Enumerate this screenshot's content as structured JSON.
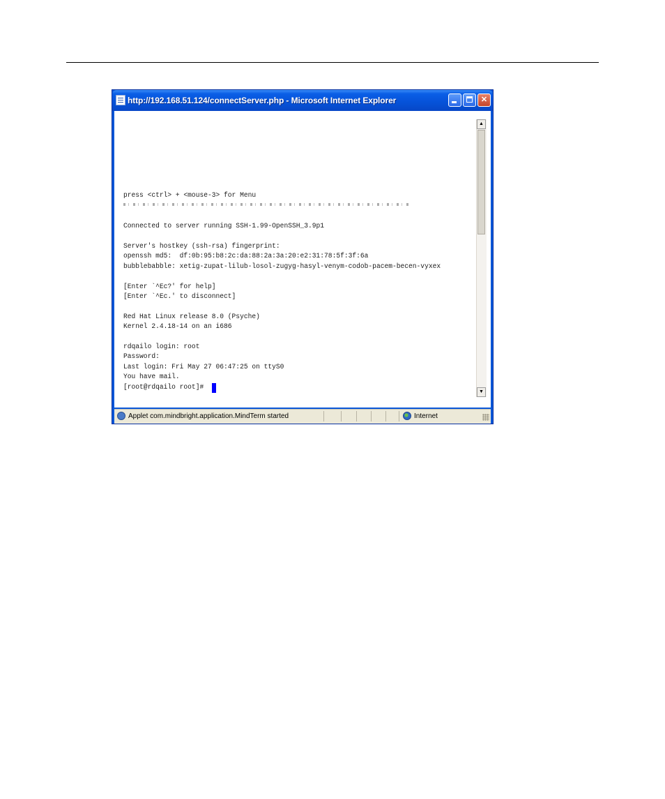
{
  "window": {
    "title": "http://192.168.51.124/connectServer.php - Microsoft Internet Explorer"
  },
  "terminal": {
    "lines": [
      "press <ctrl> + <mouse-3> for Menu",
      "Connected to server running SSH-1.99-OpenSSH_3.9p1",
      "Server's hostkey (ssh-rsa) fingerprint:",
      "openssh md5:  df:0b:95:b8:2c:da:88:2a:3a:20:e2:31:78:5f:3f:6a",
      "bubblebabble: xetig-zupat-lilub-losol-zugyg-hasyl-venym-codob-pacem-becen-vyxex",
      "[Enter `^Ec?' for help]",
      "[Enter `^Ec.' to disconnect]",
      "Red Hat Linux release 8.0 (Psyche)",
      "Kernel 2.4.18-14 on an i686",
      "rdqailo login: root",
      "Password:",
      "Last login: Fri May 27 06:47:25 on ttyS0",
      "You have mail.",
      "[root@rdqailo root]#"
    ]
  },
  "statusbar": {
    "message": "Applet com.mindbright.application.MindTerm started",
    "zone": "Internet"
  },
  "icons": {
    "window": "ie-page-icon",
    "status": "applet-icon",
    "zone": "globe-icon"
  },
  "colors": {
    "titlebar": "#0652d8",
    "cursor": "#0000ff"
  }
}
